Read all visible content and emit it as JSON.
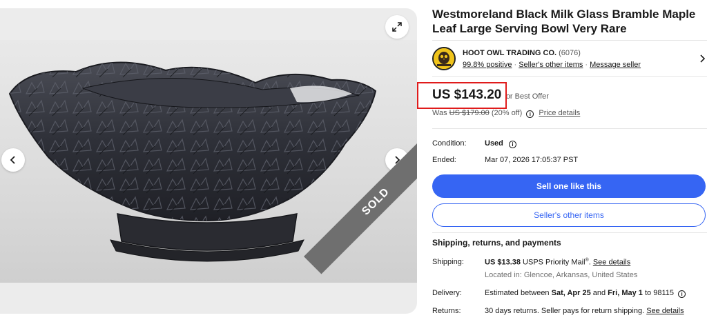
{
  "gallery": {
    "sold_label": "SOLD",
    "icons": {
      "expand": "expand-icon",
      "prev": "chevron-left-icon",
      "next": "chevron-right-icon"
    }
  },
  "listing": {
    "title": "Westmoreland Black Milk Glass Bramble Maple Leaf Large Serving Bowl Very Rare"
  },
  "seller": {
    "name": "HOOT OWL TRADING CO.",
    "feedback_count": "(6076)",
    "positive": "99.8% positive",
    "other_items_link": "Seller's other items",
    "message_link": "Message seller"
  },
  "price": {
    "current": "US $143.20",
    "best_offer": "or Best Offer",
    "was_label": "Was",
    "was_value": "US $179.00",
    "discount": "(20% off)",
    "details_link": "Price details",
    "highlight_color": "#e01b1b"
  },
  "details": {
    "condition_label": "Condition:",
    "condition_value": "Used",
    "ended_label": "Ended:",
    "ended_value": "Mar 07, 2026 17:05:37 PST"
  },
  "buttons": {
    "sell_one": "Sell one like this",
    "other_items": "Seller's other items",
    "primary_color": "#3665f3"
  },
  "shipping_section": {
    "heading": "Shipping, returns, and payments",
    "shipping_label": "Shipping:",
    "shipping_cost": "US $13.38",
    "shipping_service": "USPS Priority Mail",
    "shipping_reg": "®",
    "shipping_details_link": "See details",
    "located_in": "Located in: Glencoe, Arkansas, United States",
    "delivery_label": "Delivery:",
    "delivery_prefix": "Estimated between",
    "delivery_start": "Sat, Apr 25",
    "delivery_and": "and",
    "delivery_end": "Fri, May 1",
    "delivery_to": "to 98115",
    "returns_label": "Returns:",
    "returns_text": "30 days returns. Seller pays for return shipping.",
    "returns_details_link": "See details"
  }
}
